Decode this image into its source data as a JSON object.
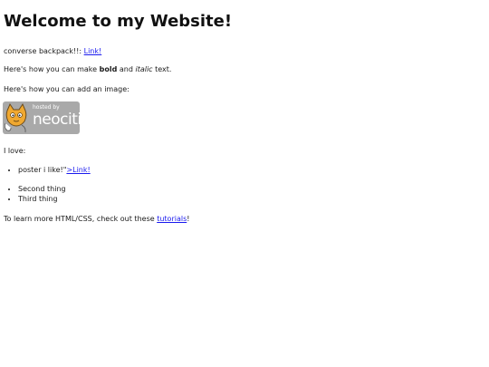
{
  "heading": "Welcome to my Website!",
  "intro": {
    "text": "converse backpack!!:",
    "link_label": "Link!"
  },
  "formatting": {
    "prefix": "Here's how you can make",
    "bold": "bold",
    "middle": "and",
    "italic": "italic",
    "suffix": "text."
  },
  "image_intro": "Here's how you can add an image:",
  "badge": {
    "icon": "neocities-cat-icon",
    "small_text": "hosted by",
    "big_text": "neocities",
    "background": "#a9a9a9"
  },
  "love_heading": "I love:",
  "list1": [
    {
      "text": "poster i like!\"",
      "link_label": ">Link!"
    }
  ],
  "list2": [
    {
      "text": "Second thing"
    },
    {
      "text": "Third thing"
    }
  ],
  "outro": {
    "prefix": "To learn more HTML/CSS, check out these",
    "link_label": "tutorials",
    "suffix": "!"
  },
  "colors": {
    "link": "#1a1aee",
    "text": "#1a1a1a"
  }
}
